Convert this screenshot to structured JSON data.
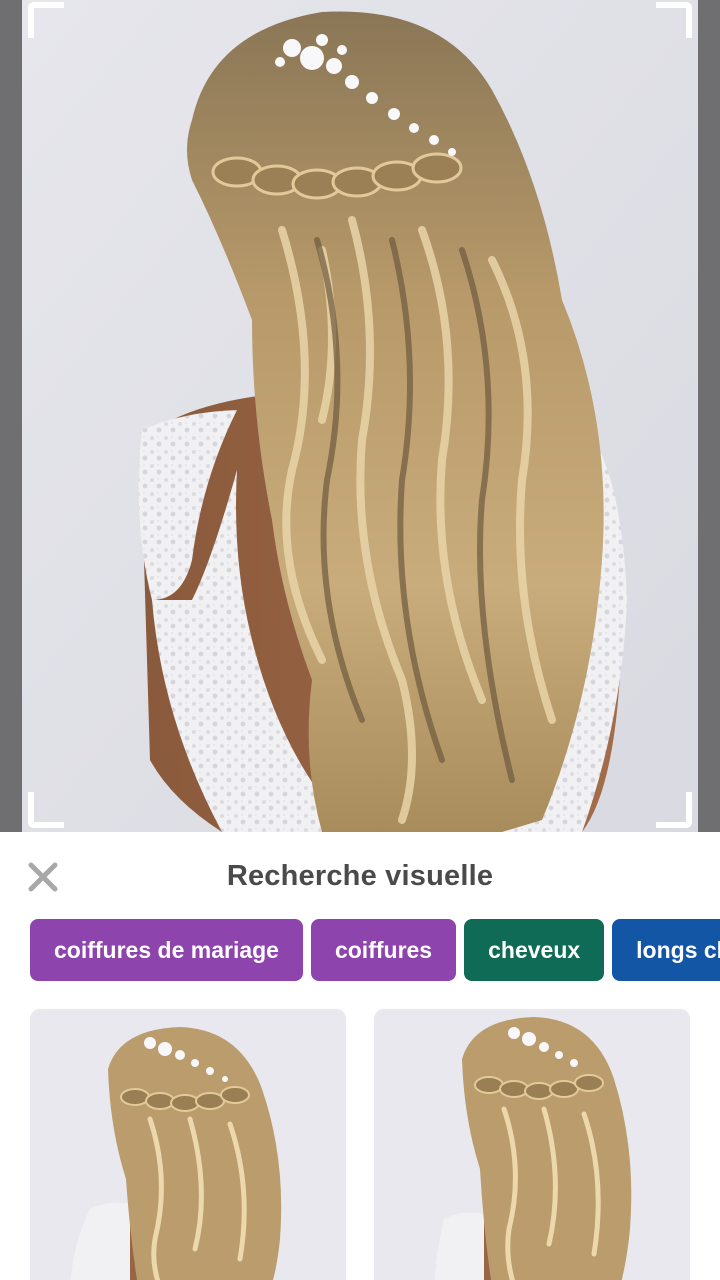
{
  "viewer": {
    "image_subject": "bridal waterfall braid half-up hairstyle with floral hairpiece"
  },
  "sheet": {
    "title": "Recherche visuelle",
    "close_icon": "close-icon"
  },
  "chips": [
    {
      "label": "coiffures de mariage",
      "color": "#8e44ad"
    },
    {
      "label": "coiffures",
      "color": "#8e44ad"
    },
    {
      "label": "cheveux",
      "color": "#0f6b55"
    },
    {
      "label": "longs cheveux",
      "color": "#1456a6"
    }
  ],
  "colors": {
    "viewer_bg": "#6f6f72",
    "photo_bg": "#e4e4ea",
    "title_text": "#4a4a4a",
    "close_icon": "#a8a8a8"
  }
}
